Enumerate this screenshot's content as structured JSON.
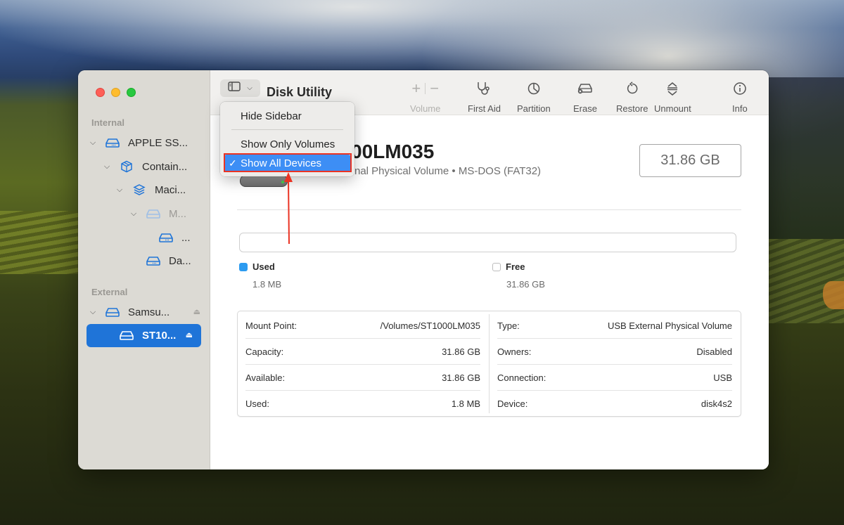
{
  "app": {
    "title": "Disk Utility"
  },
  "sidebar": {
    "sections": [
      {
        "label": "Internal",
        "items": [
          {
            "label": "APPLE SS...",
            "icon": "internal-drive-icon",
            "expanded": true
          },
          {
            "label": "Contain...",
            "icon": "container-icon",
            "expanded": true
          },
          {
            "label": "Maci...",
            "icon": "volume-group-icon",
            "expanded": true
          },
          {
            "label": "M...",
            "icon": "snapshot-drive-icon",
            "expanded": true,
            "dimmed": true
          },
          {
            "label": "...",
            "icon": "volume-drive-icon"
          },
          {
            "label": "Da...",
            "icon": "volume-drive-icon"
          }
        ]
      },
      {
        "label": "External",
        "items": [
          {
            "label": "Samsu...",
            "icon": "external-drive-icon",
            "expanded": true,
            "eject": true
          },
          {
            "label": "ST10...",
            "icon": "volume-drive-icon",
            "eject": true,
            "selected": true
          }
        ]
      }
    ]
  },
  "toolbar": {
    "volume_add": "+",
    "volume_remove": "−",
    "volume_label": "Volume",
    "first_aid_label": "First Aid",
    "partition_label": "Partition",
    "erase_label": "Erase",
    "restore_label": "Restore",
    "unmount_label": "Unmount",
    "info_label": "Info"
  },
  "view_menu": {
    "items": [
      {
        "label": "Hide Sidebar",
        "checked": false
      },
      {
        "label": "Show Only Volumes",
        "checked": false
      },
      {
        "label": "Show All Devices",
        "checked": true,
        "highlighted": true
      }
    ],
    "check_glyph": "✓"
  },
  "volume": {
    "name_visible": "00LM035",
    "description_visible": "rnal Physical Volume • MS-DOS (FAT32)",
    "size": "31.86 GB",
    "usage_fraction": 0.0001,
    "used_label": "Used",
    "used_value": "1.8 MB",
    "free_label": "Free",
    "free_value": "31.86 GB"
  },
  "details": {
    "left": [
      {
        "key": "Mount Point:",
        "value": "/Volumes/ST1000LM035"
      },
      {
        "key": "Capacity:",
        "value": "31.86 GB"
      },
      {
        "key": "Available:",
        "value": "31.86 GB"
      },
      {
        "key": "Used:",
        "value": "1.8 MB"
      }
    ],
    "right": [
      {
        "key": "Type:",
        "value": "USB External Physical Volume"
      },
      {
        "key": "Owners:",
        "value": "Disabled"
      },
      {
        "key": "Connection:",
        "value": "USB"
      },
      {
        "key": "Device:",
        "value": "disk4s2"
      }
    ]
  },
  "colors": {
    "accent": "#1f74d8",
    "menu_highlight": "#3d8ef5",
    "used_swatch": "#2c9bf0",
    "annotation_red": "#ea3323"
  }
}
